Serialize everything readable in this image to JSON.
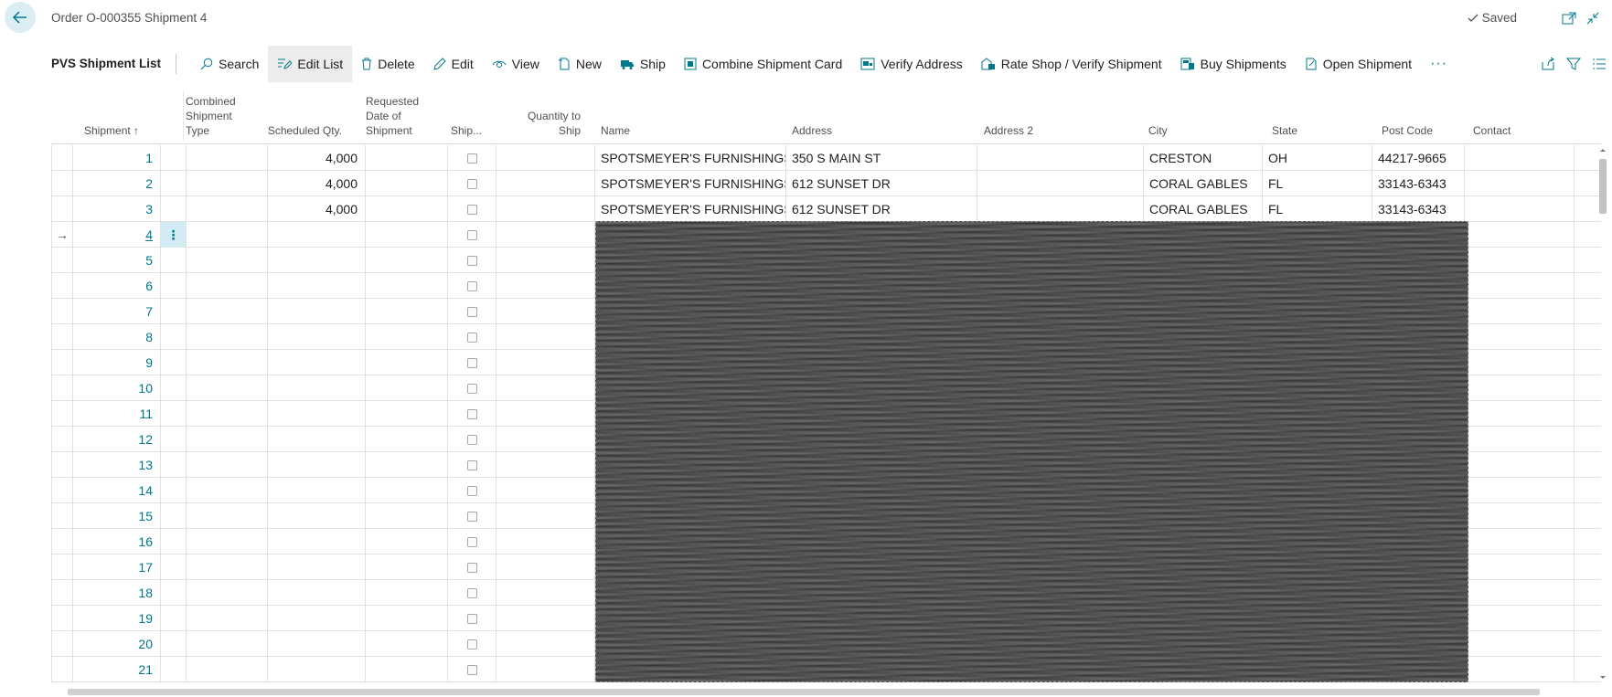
{
  "header": {
    "title": "Order O-000355 Shipment 4",
    "saved_label": "Saved"
  },
  "actionbar": {
    "page_name": "PVS Shipment List",
    "actions": [
      {
        "label": "Search",
        "icon": "search-icon"
      },
      {
        "label": "Edit List",
        "icon": "edit-list-icon"
      },
      {
        "label": "Delete",
        "icon": "delete-icon"
      },
      {
        "label": "Edit",
        "icon": "pencil-icon"
      },
      {
        "label": "View",
        "icon": "eye-icon"
      },
      {
        "label": "New",
        "icon": "new-document-icon"
      },
      {
        "label": "Ship",
        "icon": "truck-icon"
      },
      {
        "label": "Combine Shipment Card",
        "icon": "card-icon"
      },
      {
        "label": "Verify Address",
        "icon": "truck-check-icon"
      },
      {
        "label": "Rate Shop / Verify Shipment",
        "icon": "rate-shop-icon"
      },
      {
        "label": "Buy Shipments",
        "icon": "buy-icon"
      },
      {
        "label": "Open Shipment",
        "icon": "open-document-icon"
      }
    ],
    "more": "···"
  },
  "columns": {
    "shipment": "Shipment",
    "combined_type": "Combined Shipment Type",
    "scheduled_qty": "Scheduled Qty.",
    "requested_date": "Requested Date of Shipment",
    "ship": "Ship...",
    "quantity_to_ship": "Quantity to Ship",
    "name": "Name",
    "address": "Address",
    "address2": "Address 2",
    "city": "City",
    "state": "State",
    "post_code": "Post Code",
    "contact": "Contact"
  },
  "rows": [
    {
      "shipment": "1",
      "scheduled_qty": "4,000",
      "name": "SPOTSMEYER'S FURNISHINGS",
      "address": "350 S MAIN ST",
      "city": "CRESTON",
      "state": "OH",
      "post_code": "44217-9665"
    },
    {
      "shipment": "2",
      "scheduled_qty": "4,000",
      "name": "SPOTSMEYER'S FURNISHINGS",
      "address": "612 SUNSET DR",
      "city": "CORAL GABLES",
      "state": "FL",
      "post_code": "33143-6343"
    },
    {
      "shipment": "3",
      "scheduled_qty": "4,000",
      "name": "SPOTSMEYER'S FURNISHINGS",
      "address": "612 SUNSET DR",
      "city": "CORAL GABLES",
      "state": "FL",
      "post_code": "33143-6343"
    },
    {
      "shipment": "4"
    },
    {
      "shipment": "5"
    },
    {
      "shipment": "6"
    },
    {
      "shipment": "7"
    },
    {
      "shipment": "8"
    },
    {
      "shipment": "9"
    },
    {
      "shipment": "10"
    },
    {
      "shipment": "11"
    },
    {
      "shipment": "12"
    },
    {
      "shipment": "13"
    },
    {
      "shipment": "14"
    },
    {
      "shipment": "15"
    },
    {
      "shipment": "16"
    },
    {
      "shipment": "17"
    },
    {
      "shipment": "18"
    },
    {
      "shipment": "19"
    },
    {
      "shipment": "20"
    },
    {
      "shipment": "21"
    }
  ],
  "selected_row_index": 3,
  "colors": {
    "accent": "#00788c",
    "selected_cell": "#d3ecf3"
  }
}
